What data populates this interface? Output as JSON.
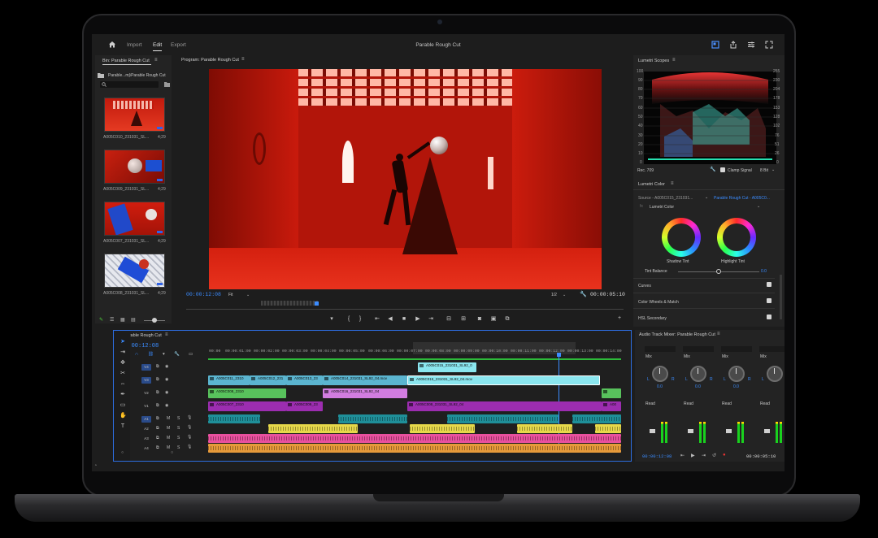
{
  "topbar": {
    "menu": [
      "Import",
      "Edit",
      "Export"
    ],
    "active": "Edit",
    "title": "Parable Rough Cut"
  },
  "bin": {
    "tab": "Bin: Parable Rough Cut",
    "path": "Parable...mj\\Parable Rough Cut",
    "clips": [
      {
        "name": "A005C010_231031_SL...",
        "duration": "4;29"
      },
      {
        "name": "A005C009_231031_SL...",
        "duration": "4;29"
      },
      {
        "name": "A005C007_231031_SL...",
        "duration": "4;29"
      },
      {
        "name": "A005C008_231031_SL...",
        "duration": "4;29"
      }
    ]
  },
  "program": {
    "tab": "Program: Parable Rough Cut",
    "timecode_current": "00:00:12:08",
    "fit": "Fit",
    "resolution": "1/2",
    "timecode_total": "00:00:05:10"
  },
  "scopes": {
    "tab": "Lumetri Scopes",
    "left_scale": [
      "100",
      "90",
      "80",
      "70",
      "60",
      "50",
      "40",
      "30",
      "20",
      "10",
      "0"
    ],
    "right_scale": [
      "255",
      "230",
      "204",
      "178",
      "153",
      "128",
      "102",
      "76",
      "51",
      "26",
      "0"
    ],
    "colorspace": "Rec. 709",
    "clamp_label": "Clamp Signal",
    "bit_depth": "8 Bit"
  },
  "lumetri": {
    "tab": "Lumetri Color",
    "source": "Source - A005C015_231031...",
    "target": "Parable Rough Cut - A005C0...",
    "effect": "Lumetri Color",
    "shadow_label": "Shadow Tint",
    "highlight_label": "Highlight Tint",
    "balance_label": "Tint Balance",
    "balance_value": "0.0",
    "sections": [
      "Curves",
      "Color Wheels & Match",
      "HSL Secondary"
    ]
  },
  "timeline": {
    "tab": "Parable Rough Cut",
    "timecode": "00:00:12:08",
    "ruler": [
      "00:00",
      "00:00:01:00",
      "00:00:02:00",
      "00:00:03:00",
      "00:00:04:00",
      "00:00:05:00",
      "00:00:06:00",
      "00:00:07:00",
      "00:00:08:00",
      "00:00:09:00",
      "00:00:10:00",
      "00:00:11:00",
      "00:00:12:00",
      "00:00:13:00",
      "00:00:14:00"
    ],
    "tracks": [
      "V4",
      "V3",
      "V2",
      "V1",
      "A1",
      "A2",
      "A3",
      "A4"
    ],
    "v4_clips": [
      "A005C015_231031_SL92_0"
    ],
    "v3_clips": [
      "A005C011_2310",
      "A005C012_231",
      "A005C013_23",
      "A005C014_231031_SL92_04.mov",
      "A005C015_231031_SL92_04.mov"
    ],
    "v2_clips": [
      "A005C008_2310",
      "A005C016_231031_SL92_04"
    ],
    "v1_clips": [
      "A005C007_2310",
      "A005C009_23",
      "A005C008_231031_SL92_04",
      "A00"
    ]
  },
  "mixer": {
    "tab": "Audio Track Mixer: Parable Rough Cut",
    "mix_label": "Mix",
    "read_label": "Read",
    "pan_value": "0.0",
    "timecode_left": "00:00:12:08",
    "timecode_right": "00:00:05:10"
  },
  "colors": {
    "accent": "#3b8cff",
    "video_clip_blue": "#5bb5d0",
    "video_clip_green": "#58c25c",
    "video_clip_pink": "#d27de0",
    "video_clip_purple": "#9c2db0",
    "audio_teal": "#1f8f99",
    "audio_yellow": "#e6d84a",
    "audio_pink": "#e8509e",
    "audio_orange": "#e79a3a"
  }
}
